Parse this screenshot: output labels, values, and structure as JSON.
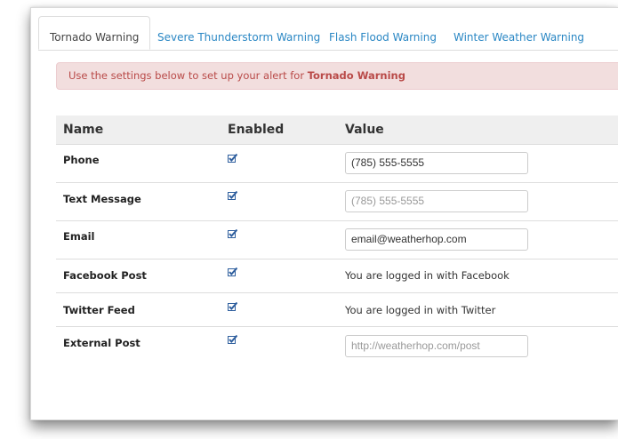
{
  "tabs": [
    {
      "label": "Tornado Warning",
      "active": true
    },
    {
      "label": "Severe Thunderstorm Warning",
      "active": false
    },
    {
      "label": "Flash Flood Warning",
      "active": false
    },
    {
      "label": "Winter Weather Warning",
      "active": false
    }
  ],
  "alert": {
    "prefix": "Use the settings below to set up your alert for ",
    "alert_name": "Tornado Warning"
  },
  "table": {
    "headers": {
      "name": "Name",
      "enabled": "Enabled",
      "value": "Value"
    },
    "rows": [
      {
        "name": "Phone",
        "enabled": true,
        "value": "(785) 555-5555",
        "placeholder": ""
      },
      {
        "name": "Text Message",
        "enabled": true,
        "value": "",
        "placeholder": "(785) 555-5555"
      },
      {
        "name": "Email",
        "enabled": true,
        "value": "email@weatherhop.com",
        "placeholder": ""
      },
      {
        "name": "Facebook Post",
        "enabled": true,
        "value_text": "You are logged in with Facebook"
      },
      {
        "name": "Twitter Feed",
        "enabled": true,
        "value_text": "You are logged in with Twitter"
      },
      {
        "name": "External Post",
        "enabled": true,
        "value": "",
        "placeholder": "http://weatherhop.com/post"
      }
    ]
  },
  "colors": {
    "link": "#2a87c4",
    "alert_bg": "#f2dede",
    "alert_text": "#b94a48",
    "checkbox": "#2f5f9e"
  },
  "icons": {
    "checkbox": "checkbox-checked-icon"
  }
}
